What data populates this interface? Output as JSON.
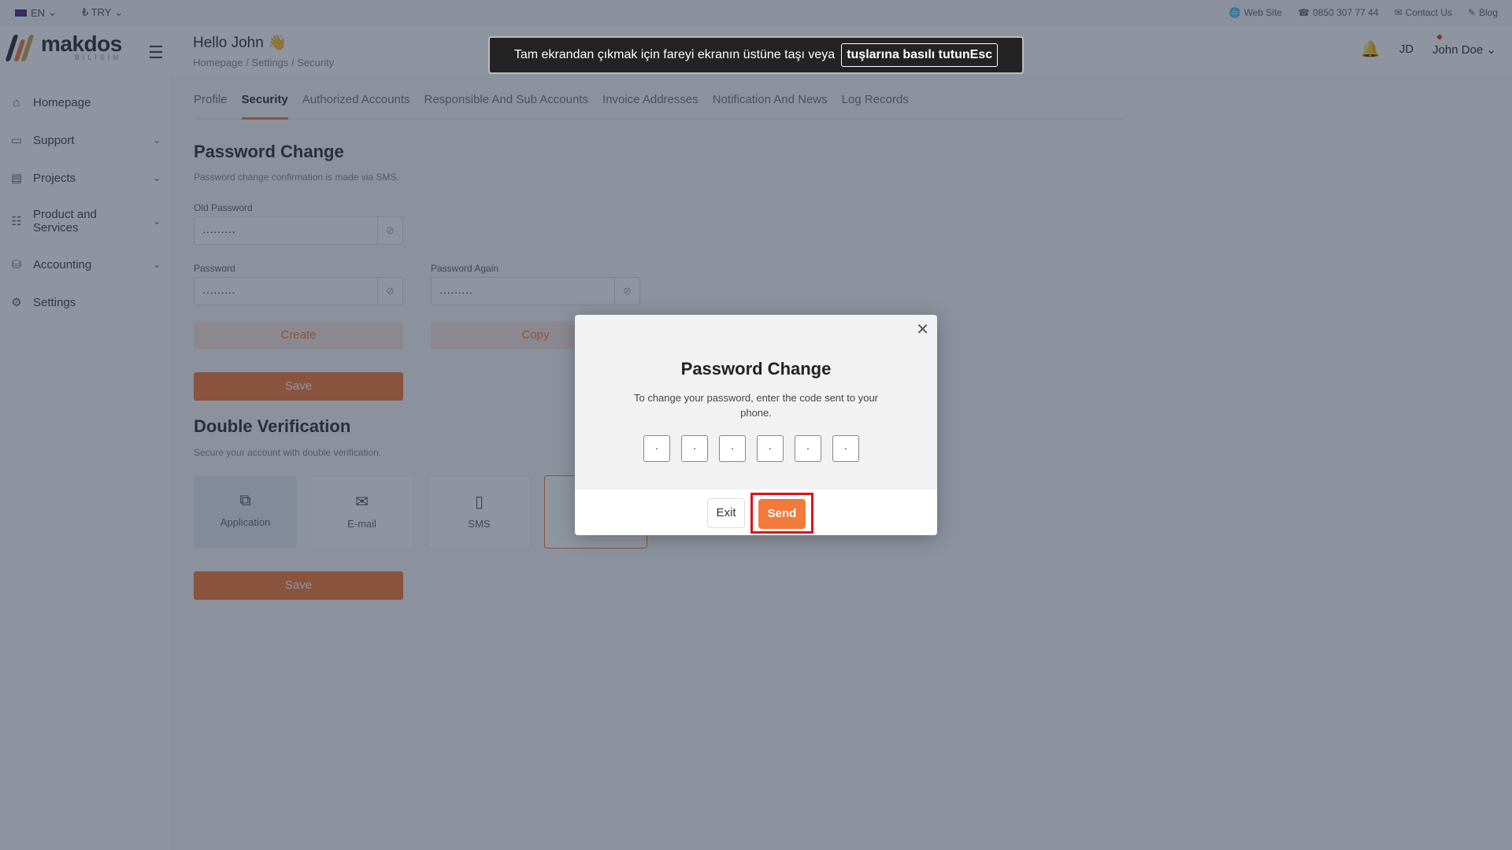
{
  "topbar": {
    "language": "EN",
    "currency": "₺ TRY",
    "links": [
      "Web Site",
      "0850 307 77 44",
      "Contact Us",
      "Blog"
    ]
  },
  "header": {
    "logo_text": "makdos",
    "logo_sub": "BILISIM",
    "greeting": "Hello John 👋",
    "breadcrumb": "Homepage / Settings / Security",
    "avatar_initials": "JD",
    "user_name": "John Doe"
  },
  "sidebar": {
    "items": [
      {
        "label": "Homepage",
        "icon": "home-icon"
      },
      {
        "label": "Support",
        "icon": "support-icon"
      },
      {
        "label": "Projects",
        "icon": "folder-icon"
      },
      {
        "label": "Product and Services",
        "icon": "list-icon"
      },
      {
        "label": "Accounting",
        "icon": "coins-icon"
      },
      {
        "label": "Settings",
        "icon": "gear-icon"
      }
    ]
  },
  "tabs": [
    "Profile",
    "Security",
    "Authorized Accounts",
    "Responsible And Sub Accounts",
    "Invoice Addresses",
    "Notification And News",
    "Log Records"
  ],
  "password_change": {
    "title": "Password Change",
    "description": "Password change confirmation is made via SMS.",
    "old_password_label": "Old Password",
    "old_password_value": "·········",
    "password_label": "Password",
    "password_value": "·········",
    "password_again_label": "Password Again",
    "password_again_value": "·········",
    "create_label": "Create",
    "copy_label": "Copy",
    "save_label": "Save"
  },
  "double_verification": {
    "title": "Double Verification",
    "description": "Secure your account with double verification.",
    "options": [
      "Application",
      "E-mail",
      "SMS"
    ],
    "save_label": "Save"
  },
  "fullscreen_notice": {
    "text": "Tam ekrandan çıkmak için fareyi ekranın üstüne taşı veya",
    "key_text": "tuşlarına basılı tutunEsc"
  },
  "modal": {
    "title": "Password Change",
    "description": "To change your password, enter the code sent to your phone.",
    "code_digits": [
      "·",
      "·",
      "·",
      "·",
      "·",
      "·"
    ],
    "exit_label": "Exit",
    "send_label": "Send"
  },
  "colors": {
    "accent": "#f27a3a",
    "highlight": "#e0101a",
    "overlay": "#202c42"
  }
}
